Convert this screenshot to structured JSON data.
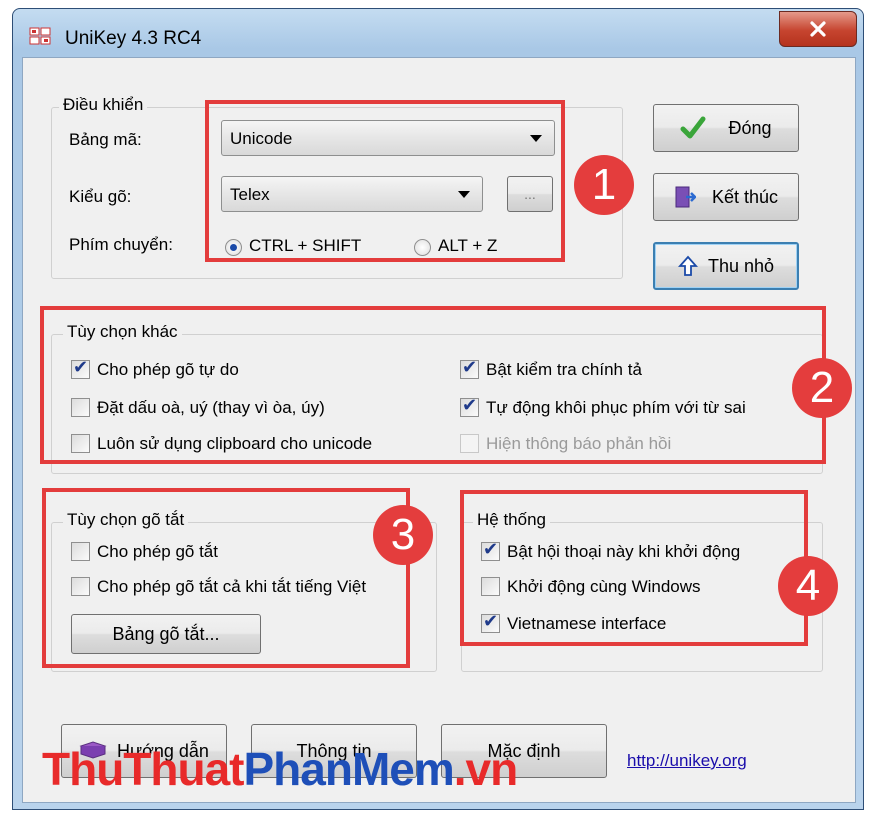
{
  "window": {
    "title": "UniKey 4.3 RC4"
  },
  "controls": {
    "legend": "Điều khiển",
    "bang_ma_label": "Bảng mã:",
    "bang_ma_value": "Unicode",
    "kieu_go_label": "Kiểu gõ:",
    "kieu_go_value": "Telex",
    "more_button": "...",
    "phim_chuyen_label": "Phím chuyển:",
    "radio_ctrl_shift": "CTRL + SHIFT",
    "radio_alt_z": "ALT + Z",
    "selected_switch_key": "CTRL + SHIFT"
  },
  "side_buttons": {
    "close": "Đóng",
    "exit": "Kết thúc",
    "minimize": "Thu nhỏ"
  },
  "options": {
    "legend": "Tùy chọn khác",
    "items": [
      {
        "label": "Cho phép gõ tự do",
        "checked": true,
        "enabled": true
      },
      {
        "label": "Đặt dấu oà, uý (thay vì òa, úy)",
        "checked": false,
        "enabled": true
      },
      {
        "label": "Luôn sử dụng clipboard cho unicode",
        "checked": false,
        "enabled": true
      },
      {
        "label": "Bật kiểm tra chính tả",
        "checked": true,
        "enabled": true
      },
      {
        "label": "Tự động khôi phục phím với từ sai",
        "checked": true,
        "enabled": true
      },
      {
        "label": "Hiện thông báo phản hồi",
        "checked": false,
        "enabled": false
      }
    ]
  },
  "shorthand": {
    "legend": "Tùy chọn gõ tắt",
    "items": [
      {
        "label": "Cho phép gõ tắt",
        "checked": false
      },
      {
        "label": "Cho phép gõ tắt cả khi tắt tiếng Việt",
        "checked": false
      }
    ],
    "table_button": "Bảng gõ tắt..."
  },
  "system": {
    "legend": "Hệ thống",
    "items": [
      {
        "label": "Bật hội thoại này khi khởi động",
        "checked": true
      },
      {
        "label": "Khởi động cùng Windows",
        "checked": false
      },
      {
        "label": "Vietnamese interface",
        "checked": true
      }
    ]
  },
  "bottom": {
    "help": "Hướng dẫn",
    "info": "Thông tin",
    "default": "Mặc định",
    "link": "http://unikey.org"
  },
  "annotations": {
    "badge1": "1",
    "badge2": "2",
    "badge3": "3",
    "badge4": "4",
    "highlight_color": "#e33c3c"
  },
  "watermark": {
    "part1": "ThuThuat",
    "part2": "PhanMem",
    "part3": ".vn"
  },
  "colors": {
    "title_gradient": "#b9d3ec",
    "close_button": "#c6442f",
    "check_color": "#1f3a8a",
    "watermark_red": "#e82a2a",
    "watermark_blue": "#1e4fb8"
  }
}
